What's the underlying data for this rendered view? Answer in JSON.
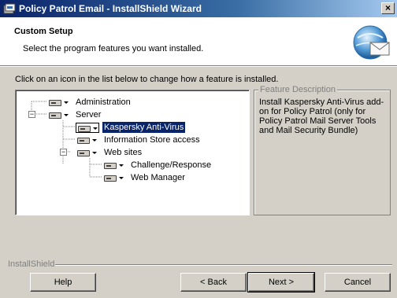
{
  "window": {
    "title": "Policy Patrol Email - InstallShield Wizard",
    "close_glyph": "×"
  },
  "banner": {
    "heading": "Custom Setup",
    "subheading": "Select the program features you want installed."
  },
  "instruction": "Click on an icon in the list below to change how a feature is installed.",
  "tree": {
    "items": [
      {
        "label": "Administration"
      },
      {
        "label": "Server"
      },
      {
        "label": "Kaspersky Anti-Virus",
        "selected": true
      },
      {
        "label": "Information Store access"
      },
      {
        "label": "Web sites"
      },
      {
        "label": "Challenge/Response"
      },
      {
        "label": "Web Manager"
      }
    ]
  },
  "description": {
    "legend": "Feature Description",
    "text": "Install Kaspersky Anti-Virus add-on for Policy Patrol (only for Policy Patrol Mail Server Tools and Mail Security Bundle)"
  },
  "footer": {
    "brand": "InstallShield"
  },
  "buttons": {
    "help": "Help",
    "back": "< Back",
    "next": "Next >",
    "cancel": "Cancel"
  },
  "colors": {
    "title_bar": "#0a246a",
    "selection": "#0a246a",
    "dialog": "#d4d0c8"
  }
}
